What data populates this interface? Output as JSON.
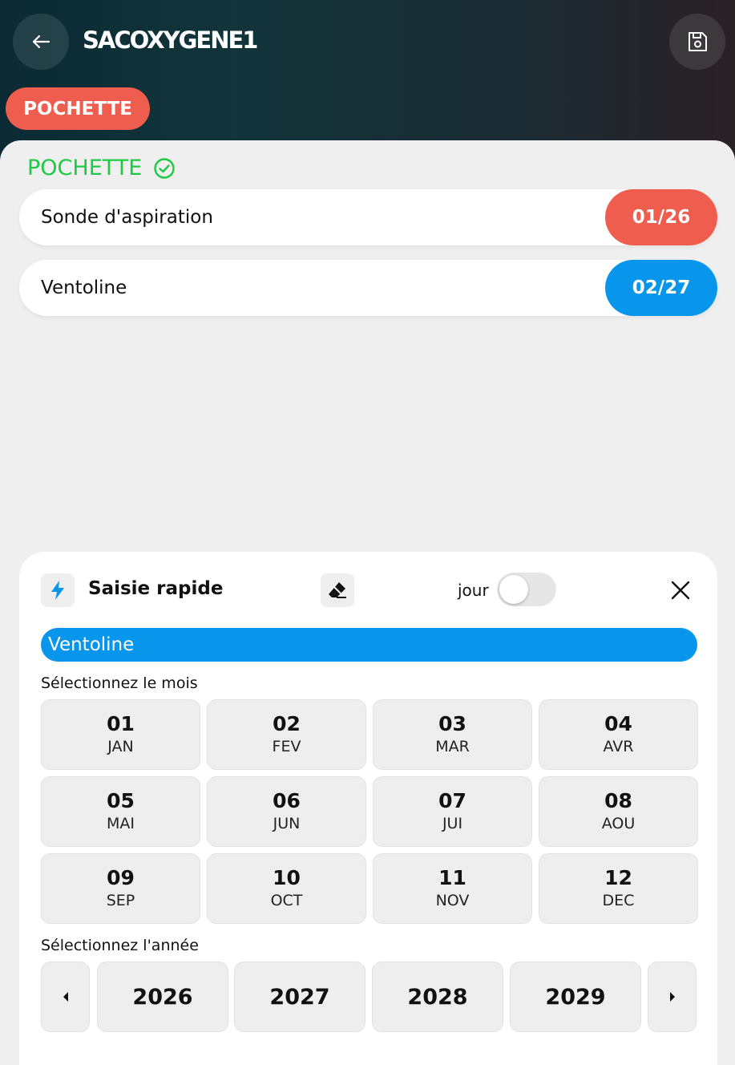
{
  "header": {
    "title": "SACOXYGENE1",
    "back_icon": "arrow-left-icon",
    "save_icon": "floppy-disk-icon",
    "category_chip": "POCHETTE",
    "chip_color": "#ef5d4f"
  },
  "section": {
    "title": "POCHETTE",
    "status_icon": "check-circle-icon",
    "title_color": "#1ec944"
  },
  "items": [
    {
      "name": "Sonde d'aspiration",
      "date": "01/26",
      "date_color": "#ef5d4f"
    },
    {
      "name": "Ventoline",
      "date": "02/27",
      "date_color": "#0896ec"
    }
  ],
  "quick_entry": {
    "bolt_icon": "lightning-icon",
    "title": "Saisie rapide",
    "eraser_icon": "eraser-icon",
    "toggle_label": "jour",
    "toggle_on": false,
    "close_icon": "close-icon",
    "selected_item": "Ventoline",
    "month_label": "Sélectionnez le mois",
    "months": [
      {
        "num": "01",
        "abbr": "JAN"
      },
      {
        "num": "02",
        "abbr": "FEV"
      },
      {
        "num": "03",
        "abbr": "MAR"
      },
      {
        "num": "04",
        "abbr": "AVR"
      },
      {
        "num": "05",
        "abbr": "MAI"
      },
      {
        "num": "06",
        "abbr": "JUN"
      },
      {
        "num": "07",
        "abbr": "JUI"
      },
      {
        "num": "08",
        "abbr": "AOU"
      },
      {
        "num": "09",
        "abbr": "SEP"
      },
      {
        "num": "10",
        "abbr": "OCT"
      },
      {
        "num": "11",
        "abbr": "NOV"
      },
      {
        "num": "12",
        "abbr": "DEC"
      }
    ],
    "year_label": "Sélectionnez l'année",
    "years": [
      "2026",
      "2027",
      "2028",
      "2029"
    ],
    "prev_icon": "caret-left-icon",
    "next_icon": "caret-right-icon"
  }
}
